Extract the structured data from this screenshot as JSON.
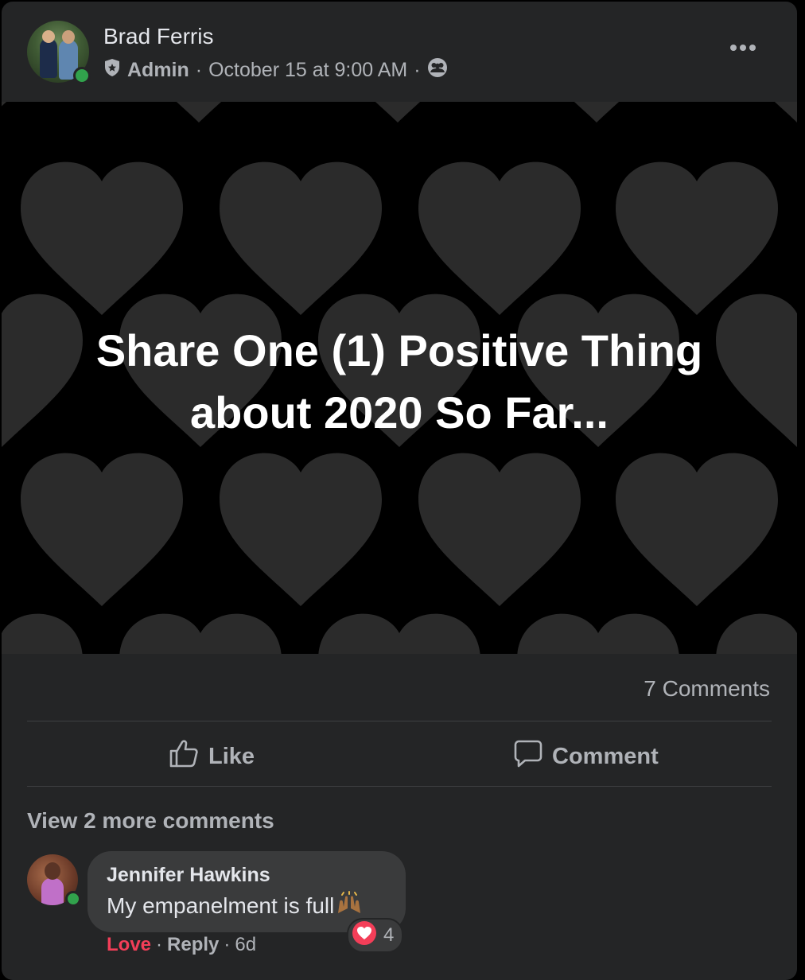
{
  "post": {
    "author": "Brad Ferris",
    "role": "Admin",
    "separator": "·",
    "timestamp": "October 15 at 9:00 AM",
    "image_text_line1": "Share One (1) Positive Thing",
    "image_text_line2": "about 2020 So Far...",
    "comments_count": "7 Comments"
  },
  "actions": {
    "like_label": "Like",
    "comment_label": "Comment"
  },
  "comments": {
    "view_more": "View 2 more comments",
    "items": [
      {
        "author": "Jennifer Hawkins",
        "text": "My empanelment is full",
        "reaction_count": "4",
        "reaction_label": "Love",
        "reply_label": "Reply",
        "age": "6d"
      }
    ]
  },
  "icons": {
    "admin_badge": "shield-icon",
    "audience": "group-audience-icon",
    "more": "more-options-icon",
    "like": "thumbs-up-icon",
    "comment": "speech-bubble-icon",
    "reaction": "heart-reaction-icon",
    "emoji": "raised-hands-emoji"
  },
  "colors": {
    "card_bg": "#242526",
    "primary_text": "#e4e6eb",
    "secondary_text": "#b0b3b8",
    "online": "#31a24c",
    "love_red": "#f33e58",
    "heart_gray": "#2a2a2a"
  }
}
